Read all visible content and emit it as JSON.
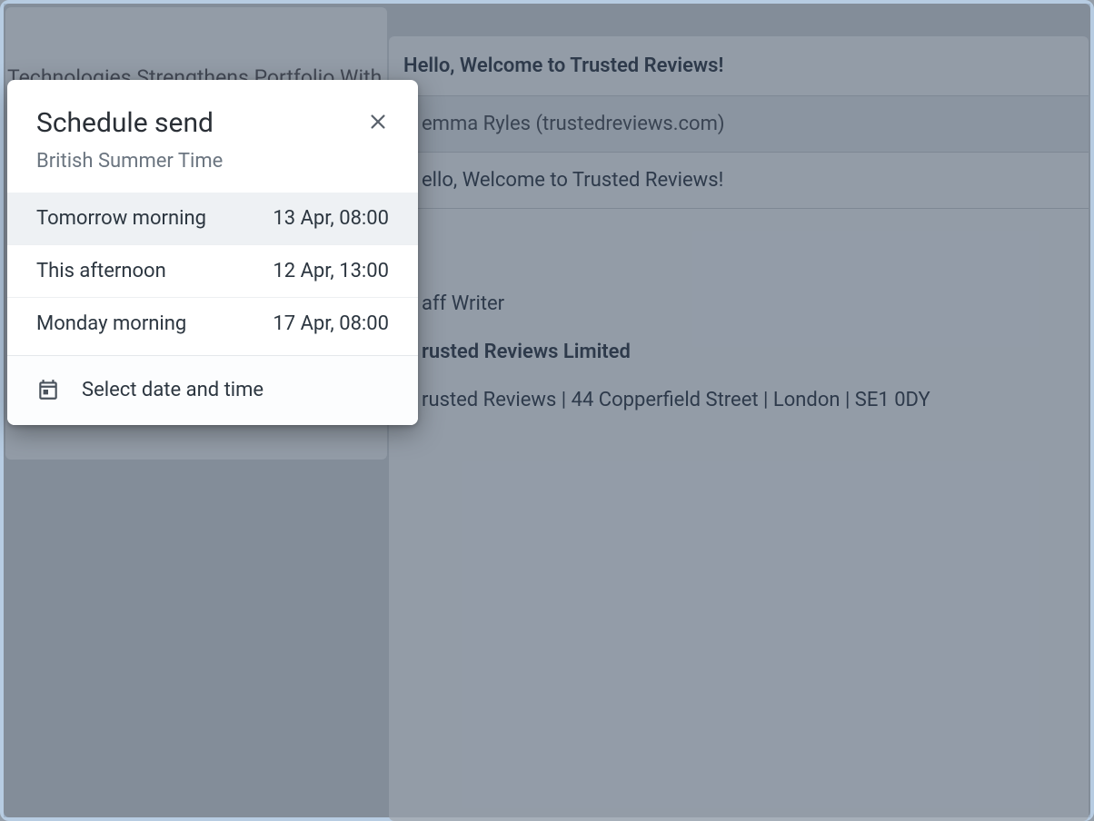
{
  "background": {
    "left_truncated_text": "Technologies Strengthens Portfolio With",
    "header_subject": "Hello, Welcome to Trusted Reviews!",
    "from": "emma Ryles (trustedreviews.com)",
    "subject_line": "ello, Welcome to Trusted Reviews!",
    "body_line1": "aff Writer",
    "body_line2": "rusted Reviews Limited",
    "body_line3": "rusted Reviews | 44 Copperfield Street | London | SE1 0DY"
  },
  "dialog": {
    "title": "Schedule send",
    "timezone": "British Summer Time",
    "options": [
      {
        "label": "Tomorrow morning",
        "time": "13 Apr, 08:00",
        "highlight": true
      },
      {
        "label": "This afternoon",
        "time": "12 Apr, 13:00",
        "highlight": false
      },
      {
        "label": "Monday morning",
        "time": "17 Apr, 08:00",
        "highlight": false
      }
    ],
    "custom_label": "Select date and time"
  }
}
